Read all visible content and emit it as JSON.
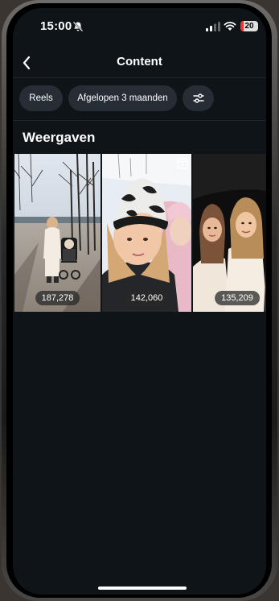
{
  "status": {
    "time": "15:00",
    "battery": "20"
  },
  "header": {
    "title": "Content"
  },
  "filters": {
    "reels": "Reels",
    "period": "Afgelopen 3 maanden"
  },
  "section": {
    "title": "Weergaven"
  },
  "tiles": [
    {
      "views": "187,278"
    },
    {
      "views": "142,060"
    },
    {
      "views": "135,209"
    }
  ]
}
